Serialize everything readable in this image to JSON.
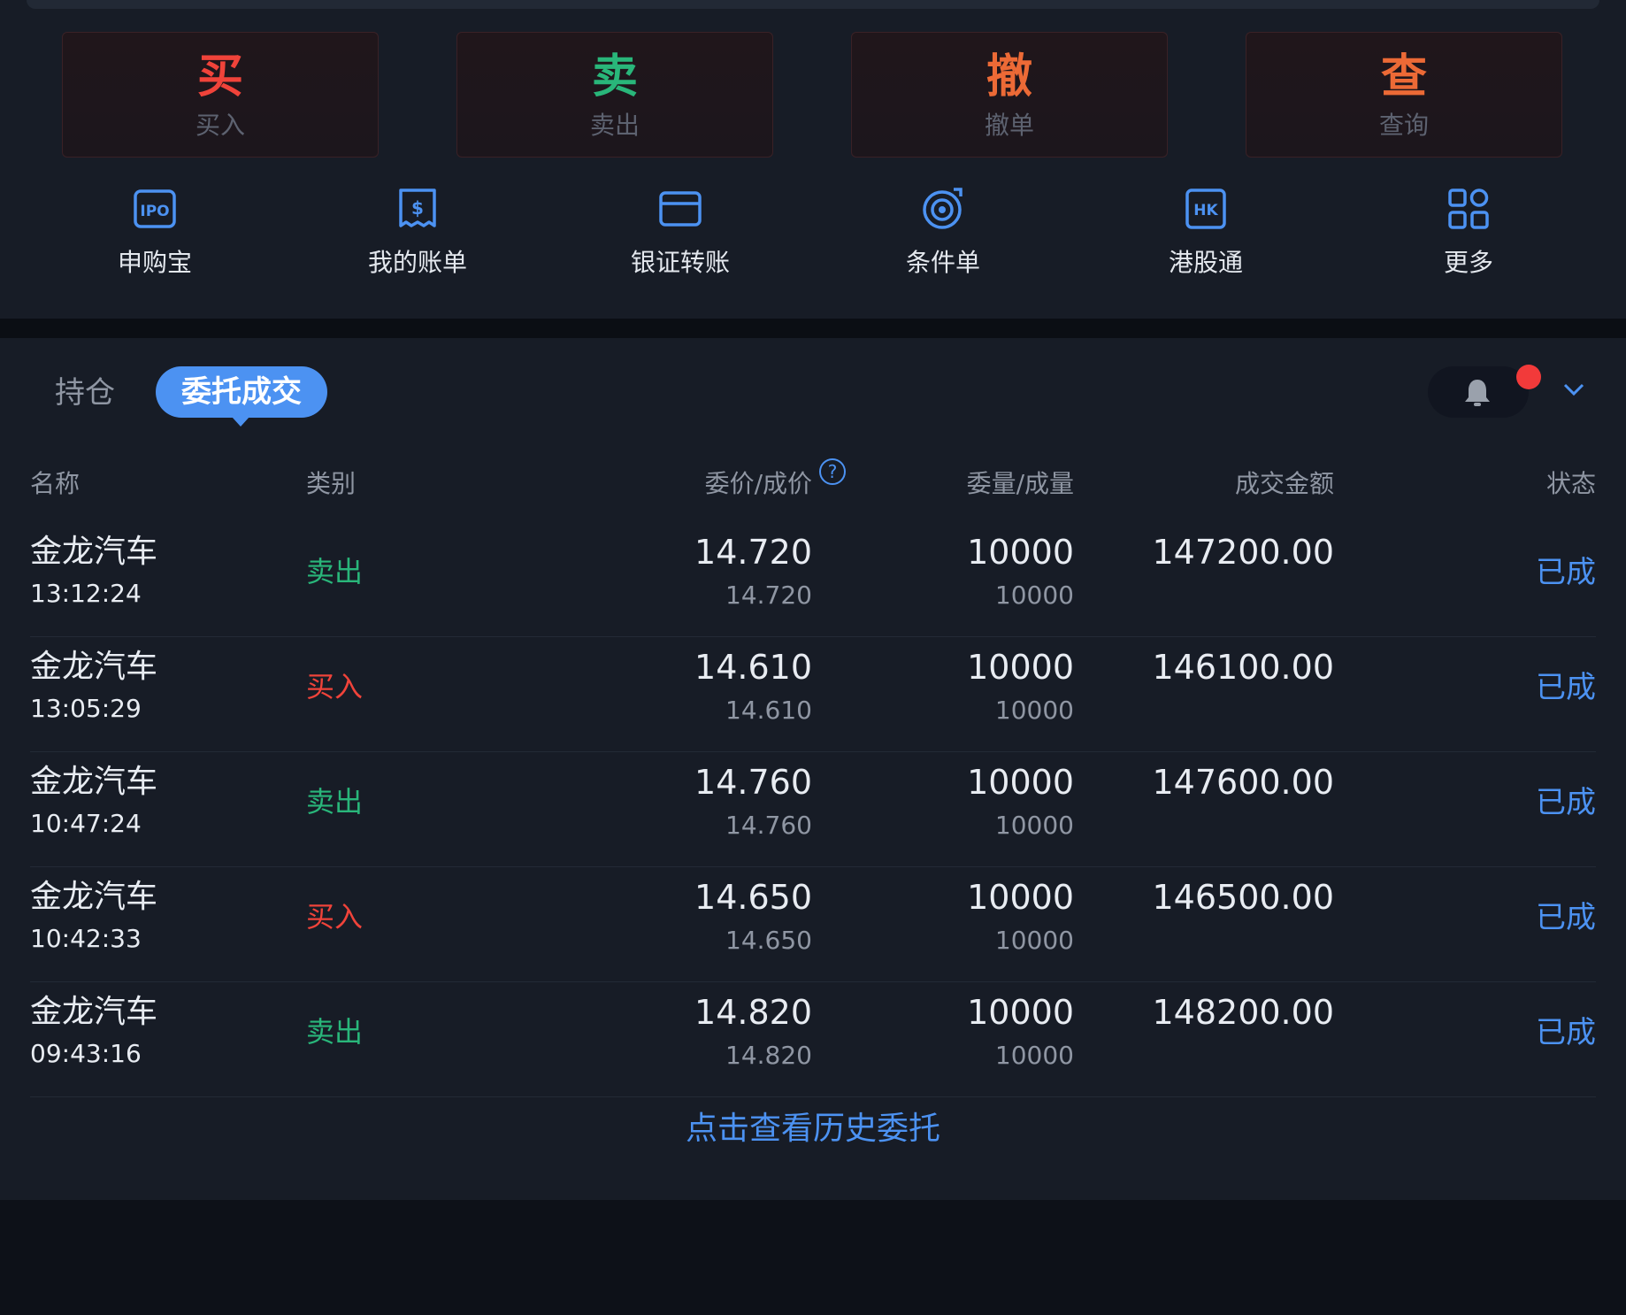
{
  "trade_buttons": [
    {
      "big": "买",
      "small": "买入",
      "color": "#f0433a"
    },
    {
      "big": "卖",
      "small": "卖出",
      "color": "#29b67a"
    },
    {
      "big": "撤",
      "small": "撤单",
      "color": "#ec6a36"
    },
    {
      "big": "查",
      "small": "查询",
      "color": "#ec6a36"
    }
  ],
  "shortcuts": [
    {
      "label": "申购宝",
      "icon": "ipo-icon"
    },
    {
      "label": "我的账单",
      "icon": "bill-icon"
    },
    {
      "label": "银证转账",
      "icon": "card-icon"
    },
    {
      "label": "条件单",
      "icon": "target-icon"
    },
    {
      "label": "港股通",
      "icon": "hk-icon"
    },
    {
      "label": "更多",
      "icon": "grid-icon"
    }
  ],
  "tabs": {
    "holdings": "持仓",
    "orders": "委托成交"
  },
  "table": {
    "headers": {
      "name": "名称",
      "side": "类别",
      "price": "委价/成价",
      "qty": "委量/成量",
      "amount": "成交金额",
      "status": "状态"
    },
    "rows": [
      {
        "name": "金龙汽车",
        "time": "13:12:24",
        "side": "卖出",
        "side_type": "sell",
        "price": "14.720",
        "deal_price": "14.720",
        "qty": "10000",
        "deal_qty": "10000",
        "amount": "147200.00",
        "status": "已成"
      },
      {
        "name": "金龙汽车",
        "time": "13:05:29",
        "side": "买入",
        "side_type": "buy",
        "price": "14.610",
        "deal_price": "14.610",
        "qty": "10000",
        "deal_qty": "10000",
        "amount": "146100.00",
        "status": "已成"
      },
      {
        "name": "金龙汽车",
        "time": "10:47:24",
        "side": "卖出",
        "side_type": "sell",
        "price": "14.760",
        "deal_price": "14.760",
        "qty": "10000",
        "deal_qty": "10000",
        "amount": "147600.00",
        "status": "已成"
      },
      {
        "name": "金龙汽车",
        "time": "10:42:33",
        "side": "买入",
        "side_type": "buy",
        "price": "14.650",
        "deal_price": "14.650",
        "qty": "10000",
        "deal_qty": "10000",
        "amount": "146500.00",
        "status": "已成"
      },
      {
        "name": "金龙汽车",
        "time": "09:43:16",
        "side": "卖出",
        "side_type": "sell",
        "price": "14.820",
        "deal_price": "14.820",
        "qty": "10000",
        "deal_qty": "10000",
        "amount": "148200.00",
        "status": "已成"
      }
    ]
  },
  "history_link": "点击查看历史委托",
  "colors": {
    "buy": "#f0433a",
    "sell": "#29b67a",
    "accent": "#4c92f2",
    "notification_dot": "#f23a3a"
  }
}
